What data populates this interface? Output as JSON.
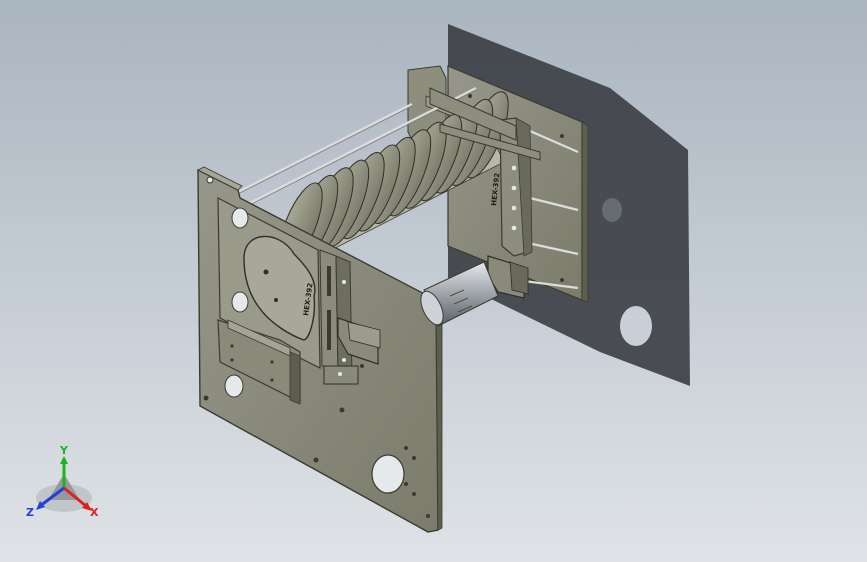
{
  "viewport": {
    "background_top": "#aab5c0",
    "background_bottom": "#dfe3e7"
  },
  "model": {
    "plate_color": "#8a8a78",
    "plate_edge_color": "#3a3a30",
    "shadow_color": "#3b3e44",
    "plate_engraving_front": "HEX-392",
    "plate_engraving_rear": "HEX-392"
  },
  "triad": {
    "x_label": "X",
    "y_label": "Y",
    "z_label": "Z",
    "x_color": "#e02020",
    "y_color": "#20b020",
    "z_color": "#2040e0"
  }
}
